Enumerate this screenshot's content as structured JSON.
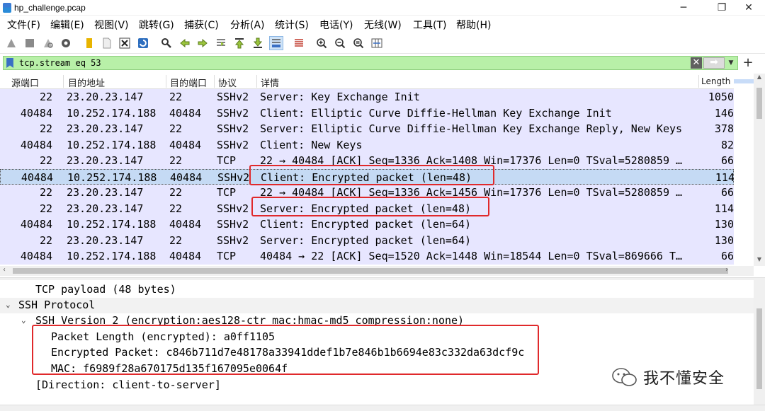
{
  "window": {
    "title": "hp_challenge.pcap",
    "controls": [
      "─",
      "❐",
      "✕"
    ]
  },
  "menu": [
    "文件(F)",
    "编辑(E)",
    "视图(V)",
    "跳转(G)",
    "捕获(C)",
    "分析(A)",
    "统计(S)",
    "电话(Y)",
    "无线(W)",
    "工具(T)",
    "帮助(H)"
  ],
  "toolbar_icons": [
    "shark-fin-start-icon",
    "stop-icon",
    "restart-icon",
    "capture-options-icon",
    "open-file-icon",
    "file-icon",
    "close-file-icon",
    "reload-icon",
    "find-icon",
    "back-icon",
    "forward-icon",
    "go-to-packet-icon",
    "first-packet-icon",
    "last-packet-icon",
    "autoscroll-icon",
    "colorize-icon",
    "zoom-in-icon",
    "zoom-out-icon",
    "zoom-reset-icon",
    "resize-columns-icon"
  ],
  "filter": {
    "value": "tcp.stream eq 53",
    "clear_glyph": "✕",
    "apply_glyph": "➡",
    "dropdown_glyph": "▼",
    "add_glyph": "+"
  },
  "packet_list": {
    "columns": [
      "源端口",
      "目的地址",
      "目的端口",
      "协议",
      "详情",
      "Length"
    ],
    "rows": [
      {
        "src_port": "22",
        "dst_addr": "23.20.23.147",
        "dst_port": "22",
        "proto": "SSHv2",
        "info": "Server: Key Exchange Init",
        "length": "1050"
      },
      {
        "src_port": "40484",
        "dst_addr": "10.252.174.188",
        "dst_port": "40484",
        "proto": "SSHv2",
        "info": "Client: Elliptic Curve Diffie-Hellman Key Exchange Init",
        "length": "146"
      },
      {
        "src_port": "22",
        "dst_addr": "23.20.23.147",
        "dst_port": "22",
        "proto": "SSHv2",
        "info": "Server: Elliptic Curve Diffie-Hellman Key Exchange Reply, New Keys",
        "length": "378"
      },
      {
        "src_port": "40484",
        "dst_addr": "10.252.174.188",
        "dst_port": "40484",
        "proto": "SSHv2",
        "info": "Client: New Keys",
        "length": "82"
      },
      {
        "src_port": "22",
        "dst_addr": "23.20.23.147",
        "dst_port": "22",
        "proto": "TCP",
        "info": "22 → 40484 [ACK] Seq=1336 Ack=1408 Win=17376 Len=0 TSval=5280859 …",
        "length": "66"
      },
      {
        "src_port": "40484",
        "dst_addr": "10.252.174.188",
        "dst_port": "40484",
        "proto": "SSHv2",
        "info": "Client: Encrypted packet (len=48)",
        "length": "114",
        "selected": true
      },
      {
        "src_port": "22",
        "dst_addr": "23.20.23.147",
        "dst_port": "22",
        "proto": "TCP",
        "info": "22 → 40484 [ACK] Seq=1336 Ack=1456 Win=17376 Len=0 TSval=5280859 …",
        "length": "66"
      },
      {
        "src_port": "22",
        "dst_addr": "23.20.23.147",
        "dst_port": "22",
        "proto": "SSHv2",
        "info": "Server: Encrypted packet (len=48)",
        "length": "114"
      },
      {
        "src_port": "40484",
        "dst_addr": "10.252.174.188",
        "dst_port": "40484",
        "proto": "SSHv2",
        "info": "Client: Encrypted packet (len=64)",
        "length": "130"
      },
      {
        "src_port": "22",
        "dst_addr": "23.20.23.147",
        "dst_port": "22",
        "proto": "SSHv2",
        "info": "Server: Encrypted packet (len=64)",
        "length": "130"
      },
      {
        "src_port": "40484",
        "dst_addr": "10.252.174.188",
        "dst_port": "40484",
        "proto": "TCP",
        "info": "40484 → 22 [ACK] Seq=1520 Ack=1448 Win=18544 Len=0 TSval=869666 T…",
        "length": "66"
      }
    ]
  },
  "details": {
    "tcp_payload": "TCP payload (48 bytes)",
    "ssh_protocol": "SSH Protocol",
    "ssh_version": "SSH Version 2 (encryption:aes128-ctr mac:hmac-md5 compression:none)",
    "packet_length": "Packet Length (encrypted): a0ff1105",
    "encrypted_packet": "Encrypted Packet: c846b711d7e48178a33941ddef1b7e846b1b6694e83c332da63dcf9c",
    "mac": "MAC: f6989f28a670175d135f167095e0064f",
    "direction": "[Direction: client-to-server]",
    "expand_glyph": "⌄"
  },
  "watermark": {
    "text": "我不懂安全",
    "icon": "wechat-icon"
  },
  "colors": {
    "filter_valid": "#b8f0a8",
    "row_bg": "#e7e6ff",
    "row_selected": "#c5daf4",
    "highlight": "#e0292b"
  }
}
